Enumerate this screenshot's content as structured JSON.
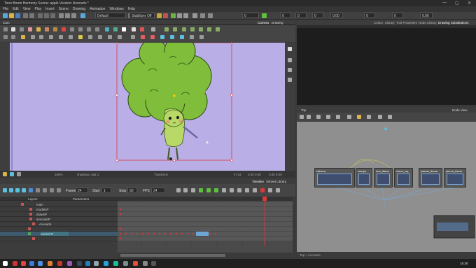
{
  "window": {
    "title": "Toon Boom Harmony Scene: apple Version: Avocado *",
    "min": "—",
    "max": "▢",
    "close": "✕"
  },
  "menu": [
    "File",
    "Edit",
    "View",
    "Play",
    "Insert",
    "Scene",
    "Drawing",
    "Animation",
    "Windows",
    "Help"
  ],
  "toolbar": {
    "view_select": "Default",
    "stabilizer_select": "Stabilizer Off",
    "zero_fields": [
      "0",
      "0",
      "0",
      "0",
      "0",
      "0"
    ],
    "zoom_field": "0.00",
    "coord": "0.00"
  },
  "camera": {
    "tab_label": "Cam",
    "view_tabs": [
      "Camera",
      "Drawing"
    ],
    "footer_zoom": "100%",
    "footer_drawing": "shadows_stat 1",
    "footer_mode": "Transform",
    "footer_frame": "Fr 24",
    "footer_coords": "0.00 0.00",
    "footer_coords2": "0.00 0.00"
  },
  "timeline": {
    "tabs": [
      "Timeline",
      "Xsheet Library"
    ],
    "frame_label": "Frame",
    "frame_value": "24",
    "start_label": "Start",
    "start_value": "1",
    "stop_label": "Stop",
    "stop_value": "90",
    "fps_label": "FPS",
    "fps_value": "24",
    "layer_header": "Layers",
    "params_header": "Parameters",
    "layers": [
      {
        "name": "main",
        "color": "#c55"
      },
      {
        "name": "modelsP",
        "color": "#c55"
      },
      {
        "name": "drawsP",
        "color": "#c55"
      },
      {
        "name": "avocadoP",
        "color": "#c55"
      },
      {
        "name": "Avocado",
        "color": "#c55"
      },
      {
        "name": "",
        "color": "#c55"
      },
      {
        "name": "normal P",
        "color": "#5a5"
      },
      {
        "name": "",
        "color": "#c55"
      }
    ]
  },
  "right_panel": {
    "tabs": [
      "Colour",
      "Library",
      "Tool Properties",
      "Node Library",
      "Drawing Substitutions"
    ]
  },
  "node_view": {
    "tab_label": "Top",
    "tab_right": "Node View",
    "nodes": [
      "cabeza",
      "cuerpo",
      "arm_llama",
      "mano_izq",
      "palmer_llama",
      "pierna_llama"
    ],
    "footer": "Top > Avocado"
  },
  "taskbar": {
    "time": "18:38",
    "date": ""
  },
  "colors": {
    "stage": "#b9aee6",
    "tree": "#7fbd3a",
    "body": "#b8d968",
    "selection": "#d83a3a",
    "accent": "#5bc0de"
  }
}
